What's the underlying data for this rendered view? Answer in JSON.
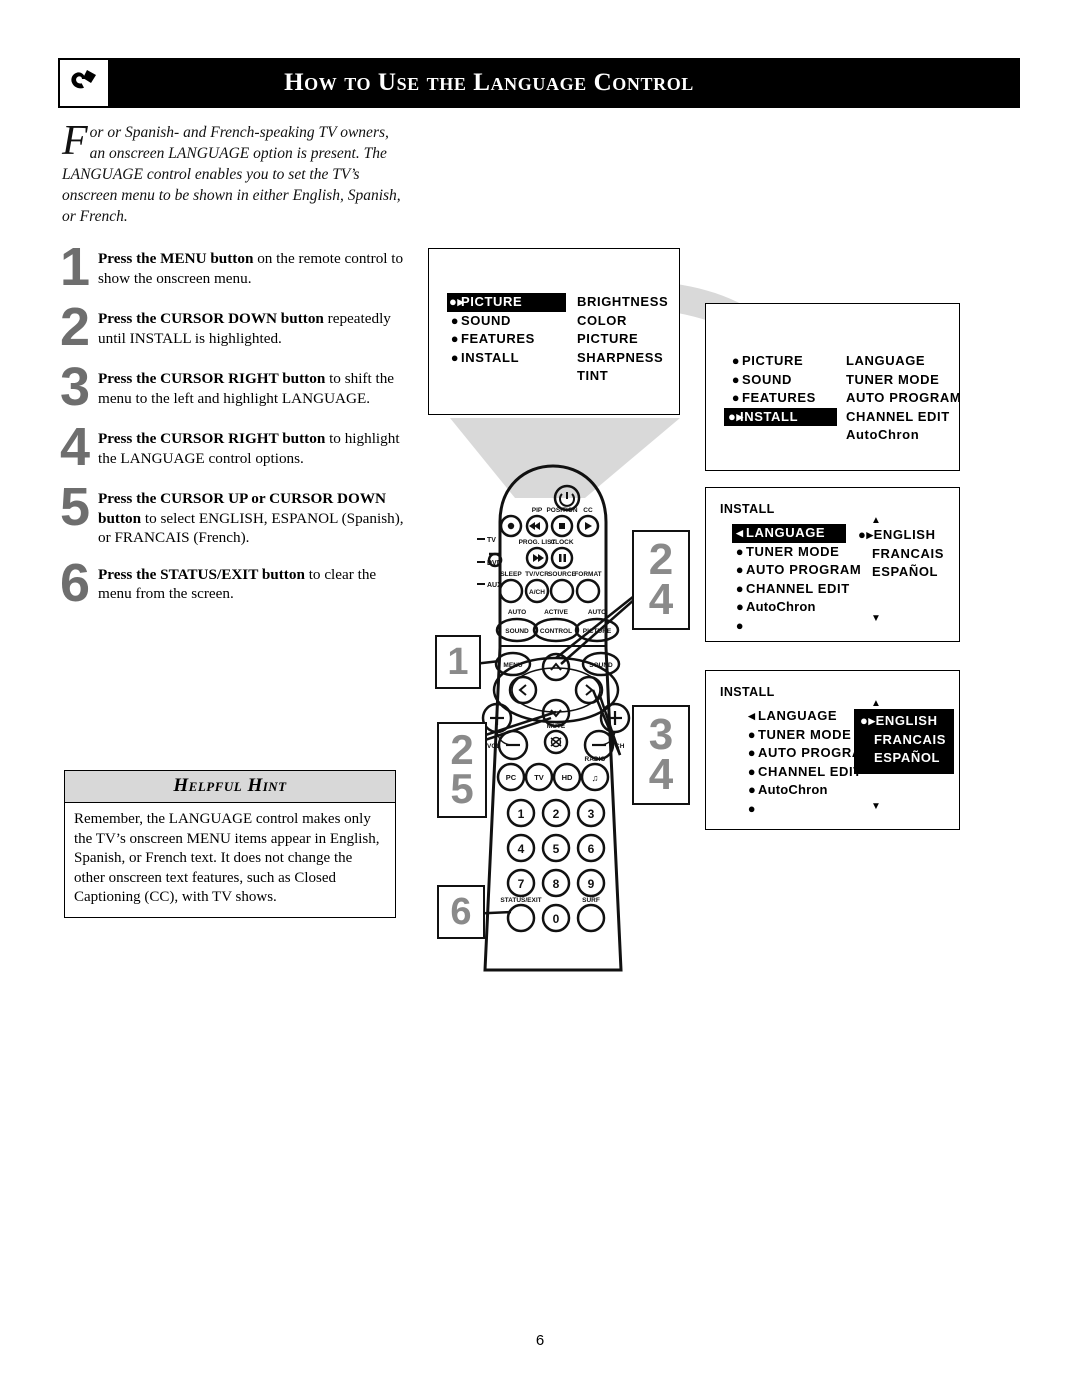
{
  "header": {
    "title": "How to Use the Language Control",
    "icon": "remote-hand-icon"
  },
  "intro": {
    "dropcap": "F",
    "text": "or or Spanish- and French-speaking TV owners, an onscreen LANGUAGE option is present.  The LANGUAGE control enables you to set the TV’s onscreen menu to be shown in either English, Spanish, or French."
  },
  "steps": [
    {
      "num": "1",
      "bold": "Press the MENU button",
      "rest": " on the remote control to show the onscreen menu."
    },
    {
      "num": "2",
      "bold": "Press the CURSOR DOWN button",
      "rest": " repeatedly until INSTALL is highlighted."
    },
    {
      "num": "3",
      "bold": "Press the CURSOR RIGHT button",
      "rest": " to shift the menu to the left and highlight LANGUAGE."
    },
    {
      "num": "4",
      "bold": "Press the CURSOR RIGHT button",
      "rest": " to highlight the LANGUAGE control options."
    },
    {
      "num": "5",
      "bold": "Press the CURSOR UP or CURSOR DOWN button",
      "rest": " to select ENGLISH, ESPANOL (Spanish), or FRANCAIS (French)."
    },
    {
      "num": "6",
      "bold": "Press the STATUS/EXIT button",
      "rest": " to clear the menu from the screen."
    }
  ],
  "hint": {
    "title": "Helpful Hint",
    "body": "Remember, the LANGUAGE control makes only the TV’s onscreen MENU items appear in English, Spanish, or French text.  It does not change the other onscreen text features, such as Closed Captioning (CC), with TV shows."
  },
  "osd1": {
    "left": [
      {
        "label": "PICTURE",
        "highlight": true,
        "marker": "●▸"
      },
      {
        "label": "SOUND",
        "highlight": false,
        "marker": "●"
      },
      {
        "label": "FEATURES",
        "highlight": false,
        "marker": "●"
      },
      {
        "label": "INSTALL",
        "highlight": false,
        "marker": "●"
      }
    ],
    "right": [
      "BRIGHTNESS",
      "COLOR",
      "PICTURE",
      "SHARPNESS",
      "TINT"
    ]
  },
  "osd2": {
    "left": [
      {
        "label": "PICTURE",
        "highlight": false,
        "marker": "●"
      },
      {
        "label": "SOUND",
        "highlight": false,
        "marker": "●"
      },
      {
        "label": "FEATURES",
        "highlight": false,
        "marker": "●"
      },
      {
        "label": "INSTALL",
        "highlight": true,
        "marker": "●▸"
      }
    ],
    "right": [
      "LANGUAGE",
      "TUNER MODE",
      "AUTO PROGRAM",
      "CHANNEL EDIT",
      "AutoChron"
    ]
  },
  "osd3": {
    "title": "INSTALL",
    "left": [
      {
        "label": "LANGUAGE",
        "highlight": true,
        "marker": "◂"
      },
      {
        "label": "TUNER MODE",
        "highlight": false,
        "marker": "●"
      },
      {
        "label": "AUTO PROGRAM",
        "highlight": false,
        "marker": "●"
      },
      {
        "label": "CHANNEL EDIT",
        "highlight": false,
        "marker": "●"
      },
      {
        "label": "AutoChron",
        "highlight": false,
        "marker": "●"
      },
      {
        "label": "",
        "highlight": false,
        "marker": "●"
      }
    ],
    "right": [
      "ENGLISH",
      "FRANCAIS",
      "ESPAÑOL"
    ],
    "right_marker": "●▸",
    "right_highlight": false,
    "scroll_up": "▲",
    "scroll_down": "▼"
  },
  "osd4": {
    "title": "INSTALL",
    "left": [
      {
        "label": "LANGUAGE",
        "highlight": false,
        "marker": "◂"
      },
      {
        "label": "TUNER MODE",
        "highlight": false,
        "marker": "●"
      },
      {
        "label": "AUTO PROGRAM",
        "highlight": false,
        "marker": "●"
      },
      {
        "label": "CHANNEL EDIT",
        "highlight": false,
        "marker": "●"
      },
      {
        "label": "AutoChron",
        "highlight": false,
        "marker": "●"
      },
      {
        "label": "",
        "highlight": false,
        "marker": "●"
      }
    ],
    "right": [
      "ENGLISH",
      "FRANCAIS",
      "ESPAÑOL"
    ],
    "right_marker": "●▸",
    "right_highlight": true,
    "scroll_up": "▲",
    "scroll_down": "▼"
  },
  "callouts": {
    "c1": "1",
    "c24_top": "2",
    "c24_bottom": "4",
    "c34_top": "3",
    "c34_bottom": "4",
    "c25_top": "2",
    "c25_bottom": "5",
    "c6": "6"
  },
  "remote": {
    "top_labels": [
      "PIP",
      "POSITION",
      "CC",
      "PROG. LIST",
      "CLOCK"
    ],
    "side_labels": [
      "TV",
      "DVD",
      "AUX"
    ],
    "row_labels": [
      "SLEEP",
      "TV/VCR",
      "SOURCE",
      "FORMAT"
    ],
    "abc_labels": [
      "AUTO",
      "ACTIVE",
      "AUTO"
    ],
    "abc_buttons": [
      "SOUND",
      "CONTROL",
      "PICTURE"
    ],
    "menu_button": "MENU",
    "sound_button": "SOUND",
    "mute_label": "MUTE",
    "vol_label": "VOL",
    "ch_label": "CH",
    "radio_label": "RADIO",
    "source_buttons": [
      "PC",
      "TV",
      "HD",
      "♫"
    ],
    "keypad": [
      "1",
      "2",
      "3",
      "4",
      "5",
      "6",
      "7",
      "8",
      "9",
      "0"
    ],
    "status_exit": "STATUS/EXIT",
    "surf": "SURF",
    "av_ch": "A/CH"
  },
  "page_number": "6",
  "colors": {
    "highlight_bg": "#000000",
    "highlight_fg": "#ffffff",
    "step_number": "#6e6e6e",
    "hint_header": "#d8d8d8",
    "beam": "#d9d9d9"
  }
}
